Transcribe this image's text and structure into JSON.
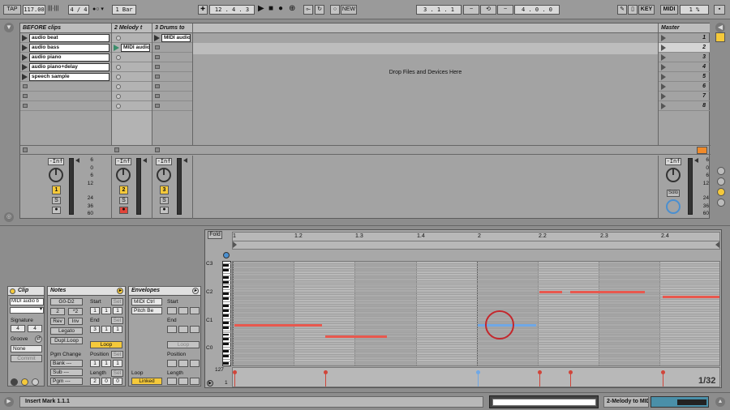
{
  "transport": {
    "tap": "TAP",
    "tempo": "117.00",
    "signature": "4 / 4",
    "quantize": "1 Bar",
    "position": "12 .  4 .  3",
    "new": "NEW",
    "loop_start": "3 .  1 .  1",
    "loop_len": "4 .  0 .  0",
    "key": "KEY",
    "midi": "MIDI",
    "cpu": "1 %"
  },
  "session": {
    "tracks": [
      {
        "name": "BEFORE clips",
        "clips": [
          "audio beat",
          "audio bass",
          "audio piano",
          "audio piano+delay",
          "speech sample"
        ]
      },
      {
        "name": "2 Melody t",
        "clips": [
          "",
          "MIDI audio b"
        ]
      },
      {
        "name": "3 Drums to",
        "clips": [
          "MIDI audio t"
        ]
      }
    ],
    "drop_text": "Drop Files and Devices Here",
    "master": {
      "name": "Master",
      "scenes": [
        "1",
        "2",
        "3",
        "4",
        "5",
        "6",
        "7",
        "8"
      ]
    },
    "mixer": {
      "vol": "-Inf",
      "scale": [
        "6",
        "0",
        "6",
        "12",
        "24",
        "36",
        "60"
      ],
      "tracks": [
        "1",
        "2",
        "3"
      ],
      "solo": "S",
      "solo_label": "Solo"
    }
  },
  "clip_view": {
    "clip": {
      "title": "Clip",
      "name": "MIDI audio b",
      "signature_label": "Signature",
      "sig_num": "4",
      "sig_den": "4",
      "groove_label": "Groove",
      "groove_value": "None",
      "commit": "Commit"
    },
    "notes": {
      "title": "Notes",
      "range": "G0-D2",
      "btn_div": "2",
      "btn_mul": "*2",
      "rev": "Rev",
      "inv": "Inv",
      "legato": "Legato",
      "dupl": "Dupl.Loop",
      "start": "Start",
      "end": "End",
      "set": "Set",
      "start_val": [
        "1",
        "1",
        "1"
      ],
      "end_val": [
        "3",
        "1",
        "1"
      ],
      "loop": "Loop",
      "position": "Position",
      "pos_val": [
        "1",
        "1",
        "1"
      ],
      "length": "Length",
      "len_val": [
        "2",
        "0",
        "0"
      ],
      "pgm_change": "Pgm Change",
      "bank": "Bank ---",
      "sub": "Sub ---",
      "pgm": "Pgm ---"
    },
    "envelopes": {
      "title": "Envelopes",
      "device": "MIDI Ctrl",
      "control": "Pitch Be",
      "start": "Start",
      "end": "End",
      "loop": "Loop",
      "position": "Position",
      "length": "Length",
      "loop_label": "Loop",
      "linked": "Linked"
    },
    "editor": {
      "fold": "Fold",
      "ruler": [
        "1",
        "1.2",
        "1.3",
        "1.4",
        "2",
        "2.2",
        "2.3",
        "2.4"
      ],
      "keys": [
        "C3",
        "C2",
        "C1",
        "C0"
      ],
      "vel_max": "127",
      "vel_min": "1",
      "zoom": "1/32"
    }
  },
  "status": {
    "text": "Insert Mark 1.1.1",
    "track": "2-Melody to MIDI"
  }
}
